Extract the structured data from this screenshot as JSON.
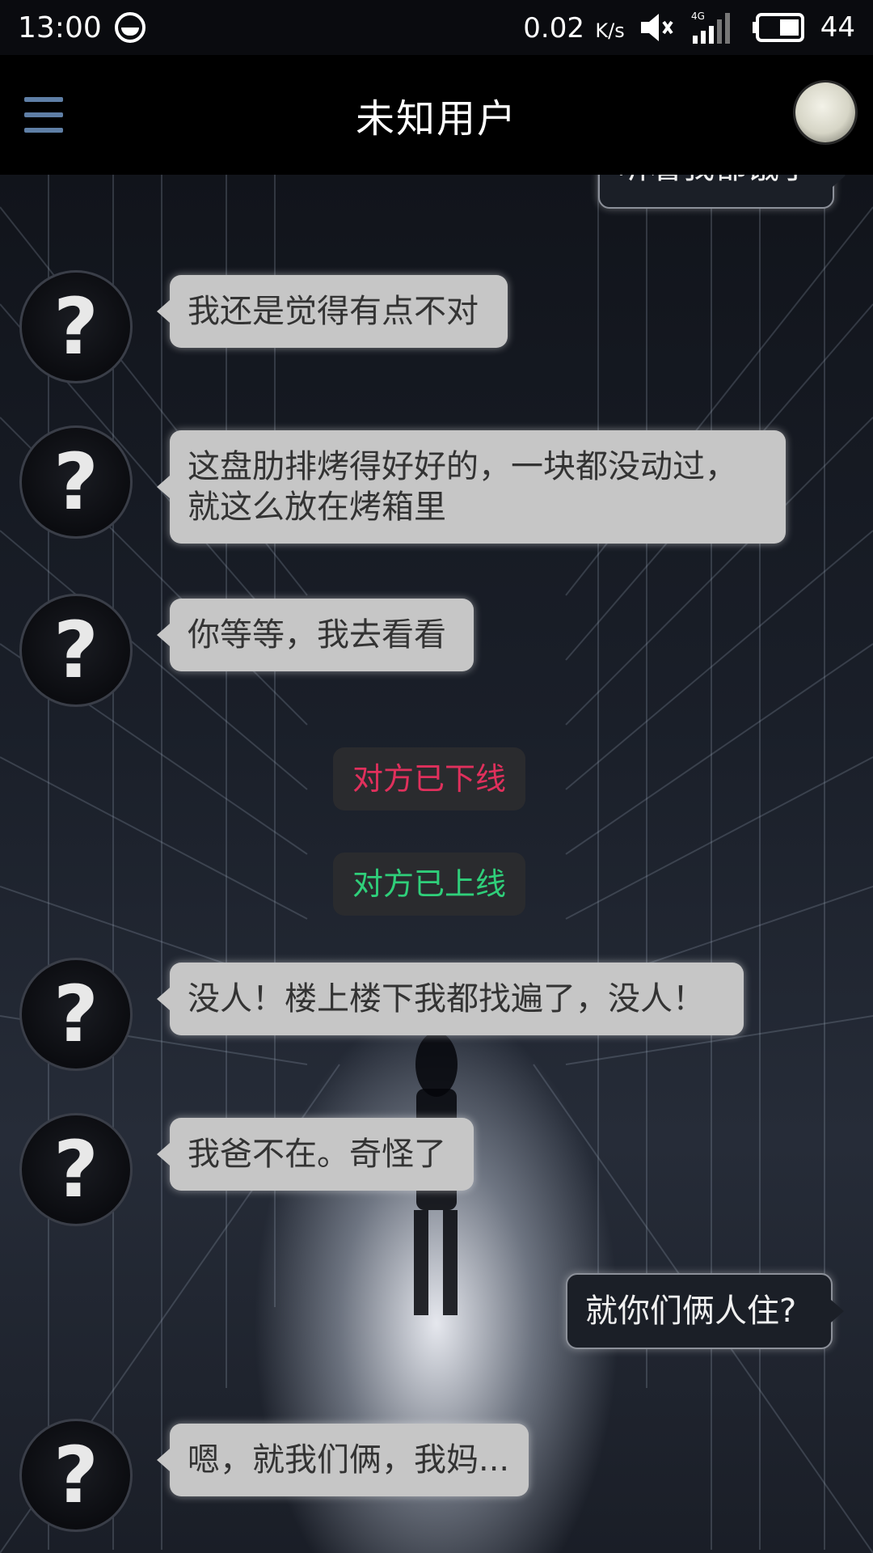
{
  "status_bar": {
    "time": "13:00",
    "net_speed": "0.02",
    "net_unit": "K/s",
    "network_type": "4G",
    "battery": "44"
  },
  "header": {
    "title": "未知用户",
    "menu_icon": "hamburger-menu-icon",
    "avatar_icon": "profile-avatar"
  },
  "messages": {
    "top_partial": "听着我都饿了",
    "m1": "我还是觉得有点不对",
    "m2_line1": "这盘肋排烤得好好的，一块都没动过，",
    "m2_line2": "就这么放在烤箱里",
    "m3": "你等等，我去看看",
    "system_offline": "对方已下线",
    "system_online": "对方已上线",
    "m4": "没人！楼上楼下我都找遍了，没人！",
    "m5": "我爸不在。奇怪了",
    "m6_out": "就你们俩人住?",
    "m7": "嗯，就我们俩，我妈..."
  },
  "avatar_symbol": "?",
  "colors": {
    "offline": "#e0305c",
    "online": "#2fcf7a",
    "incoming_bubble": "#c6c6c6",
    "outgoing_bubble": "#1b1f27"
  }
}
